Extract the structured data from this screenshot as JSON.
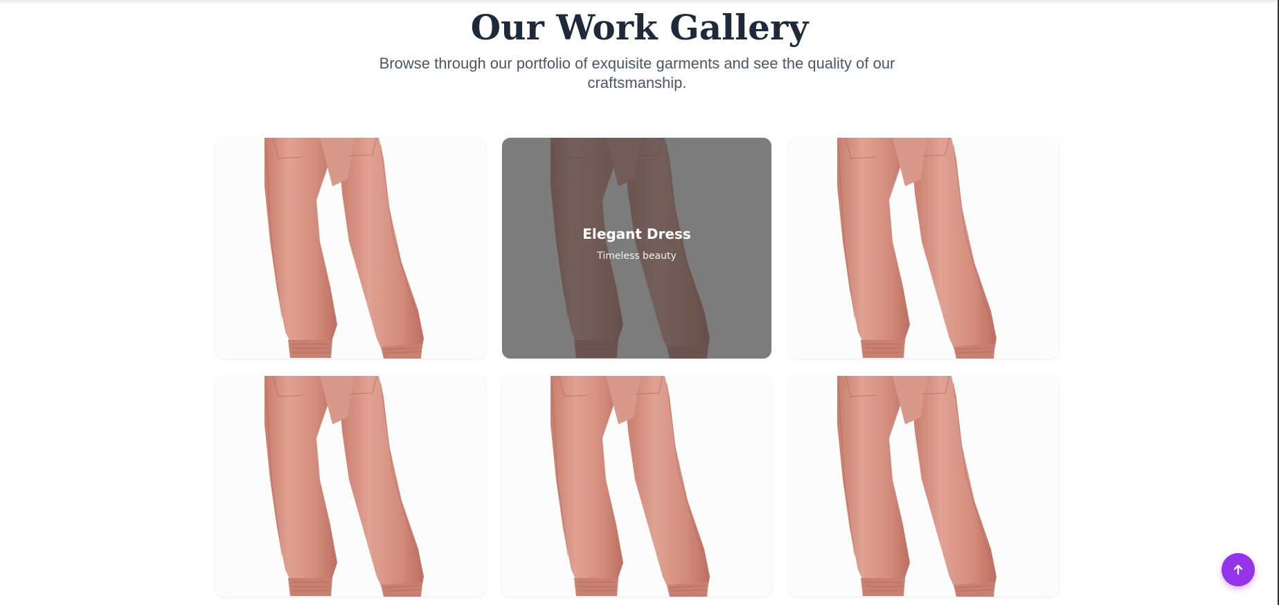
{
  "gallery": {
    "title": "Our Work Gallery",
    "subtitle": "Browse through our portfolio of exquisite garments and see the quality of our craftsmanship.",
    "items": [
      {
        "image": "pink-jogger-pants",
        "title": "",
        "caption": ""
      },
      {
        "image": "pink-jogger-pants",
        "title": "Elegant Dress",
        "caption": "Timeless beauty",
        "hovered": true
      },
      {
        "image": "pink-jogger-pants",
        "title": "",
        "caption": ""
      },
      {
        "image": "pink-jogger-pants",
        "title": "",
        "caption": ""
      },
      {
        "image": "pink-jogger-pants",
        "title": "",
        "caption": ""
      },
      {
        "image": "pink-jogger-pants",
        "title": "",
        "caption": ""
      }
    ]
  },
  "scroll_top_button": {
    "icon": "arrow-up-icon"
  },
  "colors": {
    "heading": "#1e2a3a",
    "subtitle": "#4b5563",
    "accent": "#9333ea",
    "garment": "#d99282"
  }
}
